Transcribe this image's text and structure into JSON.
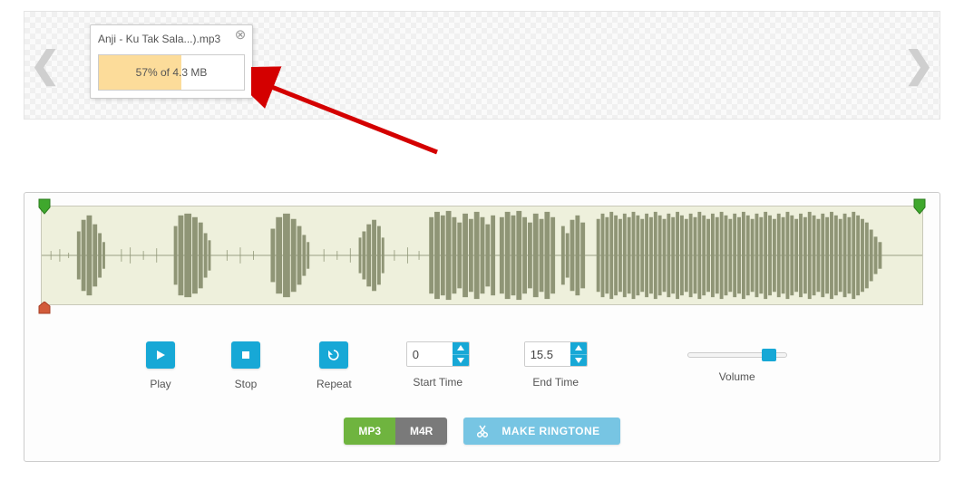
{
  "upload": {
    "filename": "Anji - Ku Tak Sala...).mp3",
    "progress_pct": 57,
    "progress_text": "57% of 4.3 MB"
  },
  "controls": {
    "play_label": "Play",
    "stop_label": "Stop",
    "repeat_label": "Repeat",
    "start_label": "Start Time",
    "end_label": "End Time",
    "volume_label": "Volume",
    "start_value": "0",
    "end_value": "15.5",
    "volume_pct": 82
  },
  "footer": {
    "mp3": "MP3",
    "m4r": "M4R",
    "make": "MAKE RINGTONE"
  }
}
